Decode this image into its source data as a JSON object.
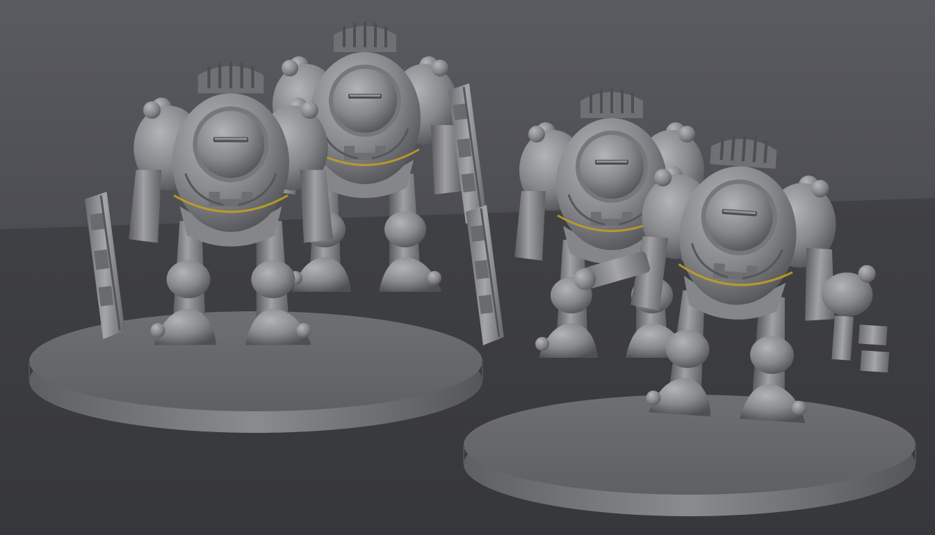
{
  "scene": {
    "subject": "3d-render-armored-miniatures",
    "colors": {
      "background_wall": "#54555a",
      "background_floor": "#3b3c40",
      "model_light": "#a3a4a8",
      "model_mid": "#7b7c80",
      "model_shadow": "#4a4b4f",
      "seam_accent": "#c6a21e"
    },
    "objects": [
      {
        "name": "left-base",
        "kind": "round-base"
      },
      {
        "name": "right-base",
        "kind": "round-base"
      },
      {
        "name": "mech-back-left",
        "kind": "armored-figure",
        "weapon": "rifle"
      },
      {
        "name": "mech-front-left",
        "kind": "armored-figure",
        "weapon": "rifle"
      },
      {
        "name": "mech-back-right",
        "kind": "armored-figure",
        "weapon": "rifle"
      },
      {
        "name": "mech-front-right",
        "kind": "armored-figure",
        "weapon": "claw"
      }
    ]
  }
}
